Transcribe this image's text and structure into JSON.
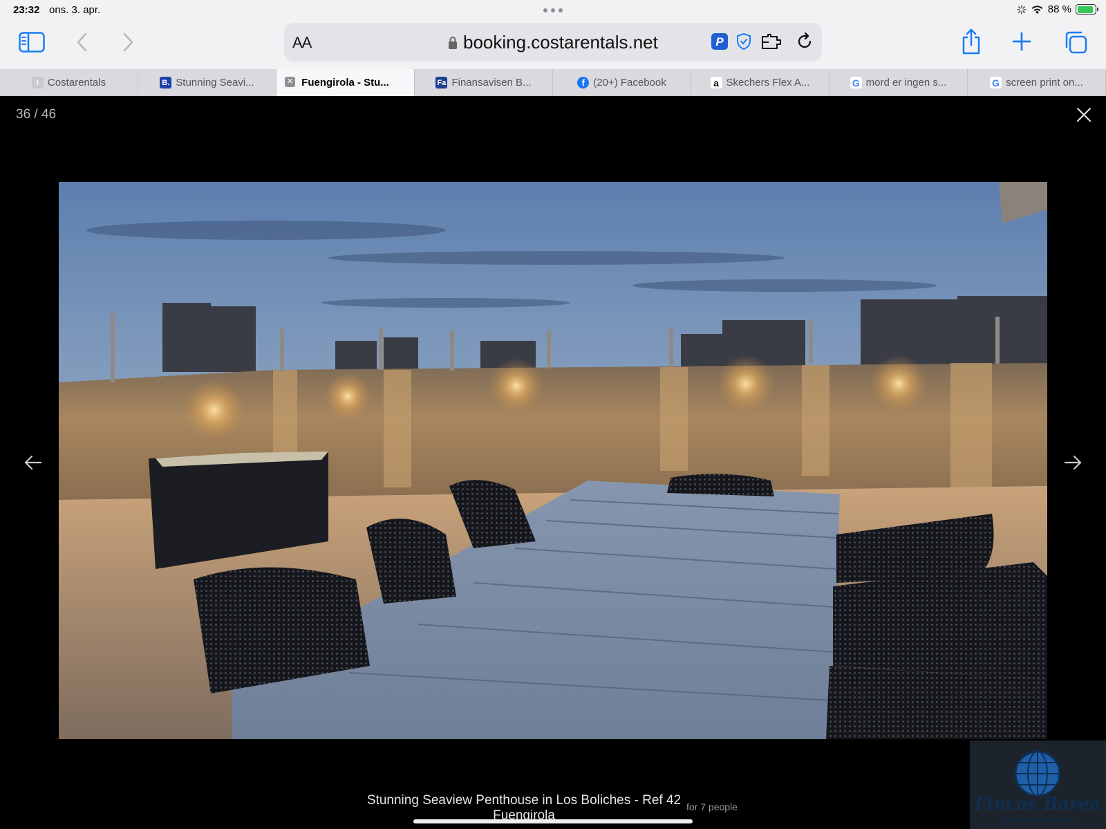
{
  "status_bar": {
    "time": "23:32",
    "date": "ons. 3. apr.",
    "battery": "88 %"
  },
  "toolbar": {
    "reader_label": "AA",
    "url": "booking.costarentals.net",
    "icons": [
      "sidebar-icon",
      "back-icon",
      "forward-icon",
      "lock-icon",
      "paypal-icon",
      "shield-icon",
      "extension-icon",
      "reload-icon",
      "share-icon",
      "plus-icon",
      "tabs-icon"
    ]
  },
  "tabs": [
    {
      "label": "Costarentals",
      "fav": "I",
      "fav_color": "#c9c9ce"
    },
    {
      "label": "Stunning Seavi...",
      "fav": "B.",
      "fav_color": "#1d3fa8"
    },
    {
      "label": "Fuengirola - Stu...",
      "fav": "",
      "fav_color": "",
      "active": true
    },
    {
      "label": "Finansavisen B...",
      "fav": "Fa",
      "fav_color": "#1c3e8f"
    },
    {
      "label": "(20+) Facebook",
      "fav": "f",
      "fav_color": "#1877f2"
    },
    {
      "label": "Skechers Flex A...",
      "fav": "a",
      "fav_color": "#ffffff"
    },
    {
      "label": "mord er ingen s...",
      "fav": "G",
      "fav_color": "#ffffff"
    },
    {
      "label": "screen print on...",
      "fav": "G",
      "fav_color": "#ffffff"
    }
  ],
  "lightbox": {
    "counter": "36 / 46",
    "caption": "Stunning Seaview Penthouse in Los Boliches - Ref 42 Fuengirola",
    "caption_sub": "for 7 people",
    "logo_text": "Fincas Barea",
    "logo_sub": "Gestión Inmobiliaria"
  }
}
